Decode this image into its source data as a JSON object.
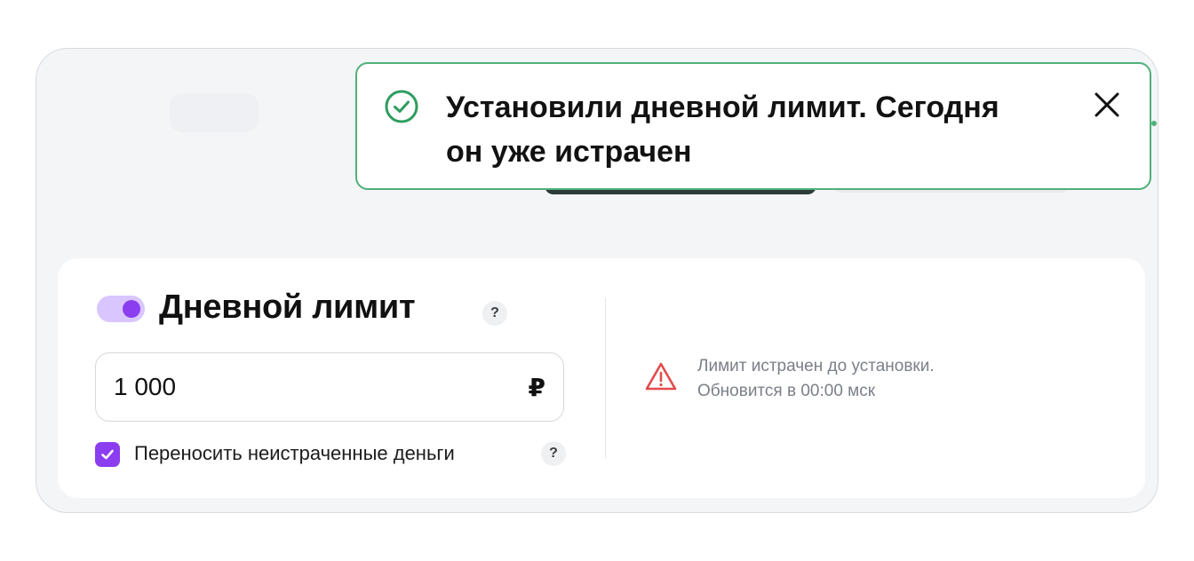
{
  "notification": {
    "line1": "Установили дневной лимит. Сегодня",
    "line2": "он уже истрачен",
    "status": "success",
    "icon": "check-circle-icon",
    "close_icon": "close-icon",
    "accent_color": "#4fb07a"
  },
  "daily_limit": {
    "enabled": true,
    "title": "Дневной лимит",
    "help": "?",
    "amount": "1 000",
    "currency": "₽",
    "rollover_checked": true,
    "rollover_label": "Переносить неистраченные деньги",
    "rollover_help": "?",
    "accent_color": "#8b3df0"
  },
  "warning": {
    "line1": "Лимит истрачен до установки.",
    "line2": "Обновится в 00:00 мск",
    "icon": "warning-triangle-icon",
    "color": "#e24b4b"
  }
}
